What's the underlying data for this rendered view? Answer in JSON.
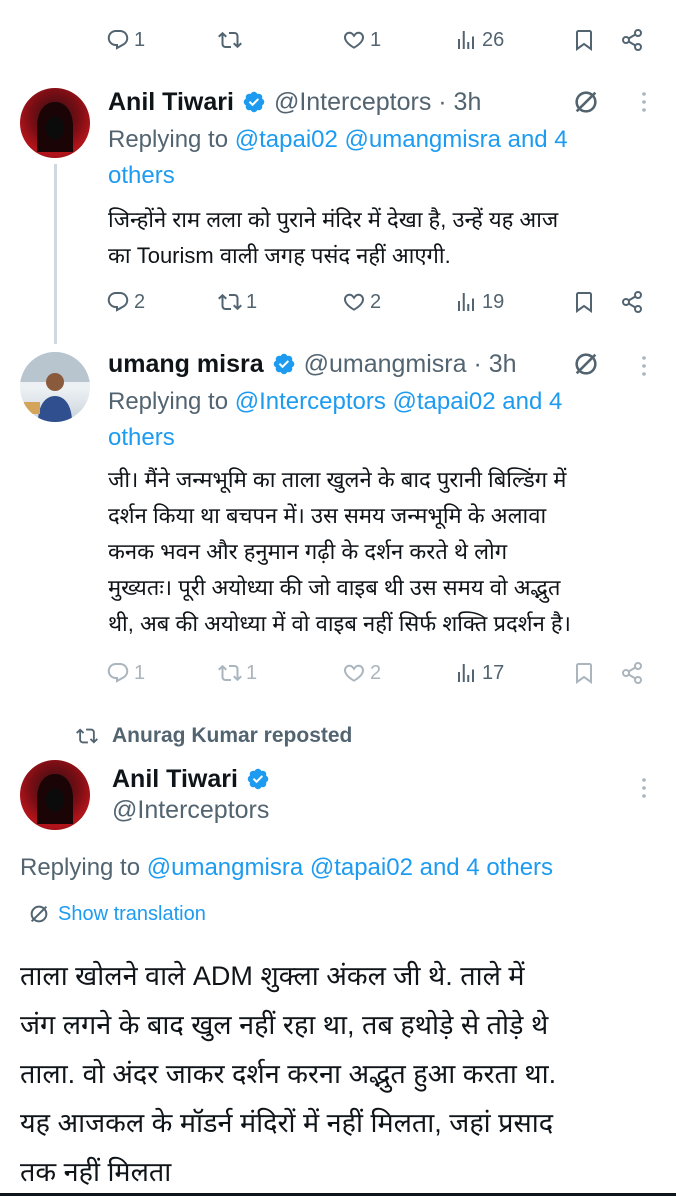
{
  "top_actions": {
    "replies": "1",
    "retweets": "",
    "likes": "1",
    "views": "26"
  },
  "reply1": {
    "name": "Anil Tiwari",
    "handle": "@Interceptors · 3h",
    "replying_prefix": "Replying to ",
    "replying_to": "@tapai02 @umangmisra and 4",
    "replying_to_2": "others",
    "text_line1": "जिन्होंने राम लला को पुराने मंदिर में देखा है, उन्हें यह आज",
    "text_line2": "का Tourism वाली जगह पसंद नहीं आएगी.",
    "actions": {
      "replies": "2",
      "retweets": "1",
      "likes": "2",
      "views": "19"
    }
  },
  "reply2": {
    "name": "umang misra",
    "handle": "@umangmisra · 3h",
    "replying_prefix": "Replying to ",
    "replying_to": "@Interceptors @tapai02 and 4",
    "replying_to_2": "others",
    "text_lines": [
      "जी। मैंने जन्मभूमि का ताला खुलने के बाद पुरानी बिल्डिंग में",
      "दर्शन किया था बचपन में। उस समय जन्मभूमि के अलावा",
      "कनक भवन और हनुमान गढ़ी के दर्शन करते थे लोग",
      "मुख्यतः। पूरी अयोध्या की जो वाइब थी उस समय वो अद्भुत",
      "थी, अब की अयोध्या में वो वाइब नहीं सिर्फ शक्ति प्रदर्शन है।"
    ],
    "actions": {
      "replies": "1",
      "retweets": "1",
      "likes": "2",
      "views": "17"
    }
  },
  "main": {
    "repost_label": "Anurag Kumar reposted",
    "name": "Anil Tiwari",
    "handle": "@Interceptors",
    "replying_prefix": "Replying to ",
    "replying_to": "@umangmisra @tapai02 and 4 others",
    "show_translation": "Show translation",
    "text_lines": [
      "ताला खोलने वाले ADM शुक्ला अंकल जी थे. ताले में",
      "जंग लगने के बाद खुल नहीं रहा था, तब हथोड़े से तोड़े थे",
      "ताला. वो अंदर जाकर दर्शन करना अद्भुत हुआ करता था.",
      "यह आजकल के मॉडर्न मंदिरों में नहीं मिलता, जहां प्रसाद",
      "तक नहीं मिलता"
    ]
  },
  "icons": {
    "reply": "reply-icon",
    "retweet": "retweet-icon",
    "like": "heart-icon",
    "views": "views-icon",
    "bookmark": "bookmark-icon",
    "share": "share-icon",
    "grok": "grok-icon",
    "more": "more-icon",
    "verified": "verified-badge-icon"
  },
  "colors": {
    "accent": "#1d9bf0",
    "muted": "#536471",
    "text": "#0f1419"
  }
}
